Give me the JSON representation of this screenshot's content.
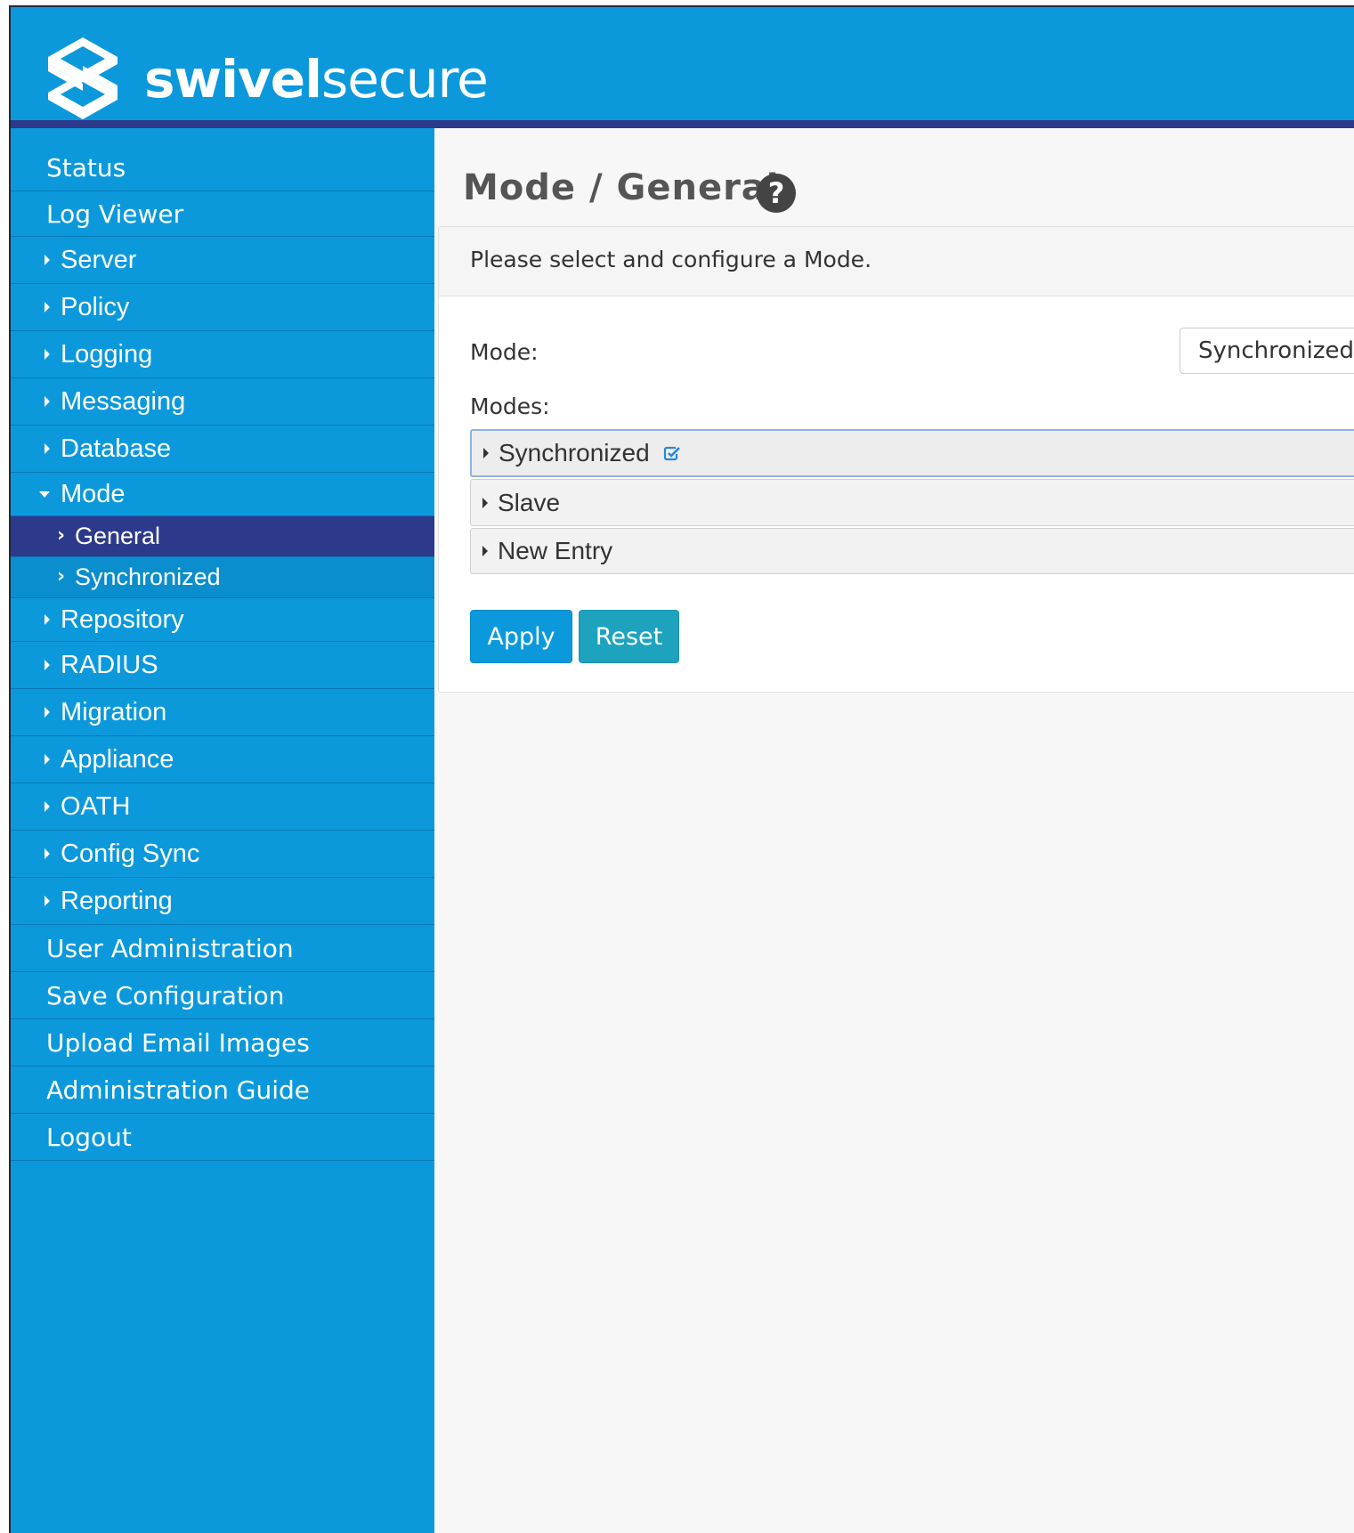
{
  "brand": {
    "name_bold": "swivel",
    "name_light": "secure"
  },
  "colors": {
    "header": "#0b99dc",
    "header_underline": "#2d3a8c",
    "sidebar": "#0b99dc",
    "sidebar_active": "#2d3a8c",
    "apply_button": "#0b99dc",
    "reset_button": "#1ea3bf"
  },
  "sidebar": {
    "items": [
      {
        "label": "Status",
        "type": "top"
      },
      {
        "label": "Log Viewer",
        "type": "top"
      },
      {
        "label": "Server",
        "type": "collapsed"
      },
      {
        "label": "Policy",
        "type": "collapsed"
      },
      {
        "label": "Logging",
        "type": "collapsed"
      },
      {
        "label": "Messaging",
        "type": "collapsed"
      },
      {
        "label": "Database",
        "type": "collapsed"
      },
      {
        "label": "Mode",
        "type": "expanded"
      },
      {
        "label": "General",
        "type": "child",
        "active": true
      },
      {
        "label": "Synchronized",
        "type": "child"
      },
      {
        "label": "Repository",
        "type": "collapsed"
      },
      {
        "label": "RADIUS",
        "type": "collapsed"
      },
      {
        "label": "Migration",
        "type": "collapsed"
      },
      {
        "label": "Appliance",
        "type": "collapsed"
      },
      {
        "label": "OATH",
        "type": "collapsed"
      },
      {
        "label": "Config Sync",
        "type": "collapsed"
      },
      {
        "label": "Reporting",
        "type": "collapsed"
      },
      {
        "label": "User Administration",
        "type": "top"
      },
      {
        "label": "Save Configuration",
        "type": "top"
      },
      {
        "label": "Upload Email Images",
        "type": "top"
      },
      {
        "label": "Administration Guide",
        "type": "top"
      },
      {
        "label": "Logout",
        "type": "top"
      }
    ]
  },
  "main": {
    "title": "Mode / General",
    "help_icon": "question-circle-icon",
    "panel_header": "Please select and configure a Mode.",
    "mode_label": "Mode:",
    "mode_value": "Synchronized",
    "modes_label": "Modes:",
    "modes": [
      {
        "label": "Synchronized",
        "selected": true,
        "icon": "edit-check-icon"
      },
      {
        "label": "Slave",
        "selected": false
      },
      {
        "label": "New Entry",
        "selected": false
      }
    ],
    "apply_label": "Apply",
    "reset_label": "Reset"
  }
}
